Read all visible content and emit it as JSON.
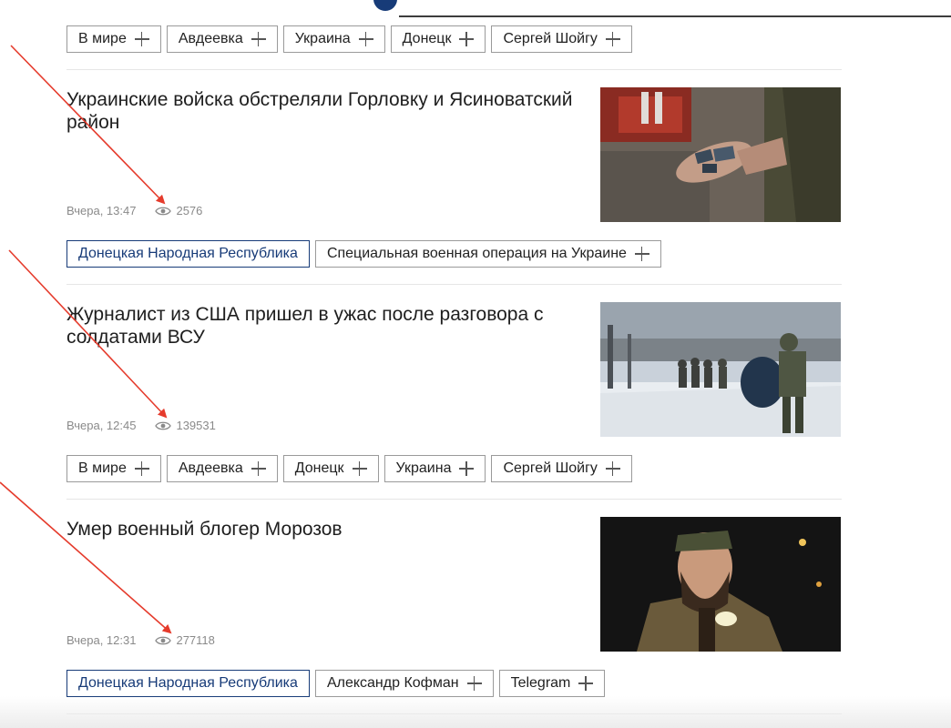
{
  "theme": {
    "accent": "#173b78",
    "arrow": "#e53b2c",
    "meta_text": "#8a8a8a"
  },
  "top_tags": [
    {
      "label": "В мире",
      "active": false
    },
    {
      "label": "Авдеевка",
      "active": false
    },
    {
      "label": "Украина",
      "active": false
    },
    {
      "label": "Донецк",
      "active": false
    },
    {
      "label": "Сергей Шойгу",
      "active": false
    }
  ],
  "articles": [
    {
      "title": "Украинские войска обстреляли Горловку и Ясиноватский район",
      "time": "Вчера, 13:47",
      "views": "2576",
      "image": "soldier-hand-with-shrapnel-photo",
      "tags": [
        {
          "label": "Донецкая Народная Республика",
          "active": true
        },
        {
          "label": "Специальная военная операция на Украине",
          "active": false
        }
      ]
    },
    {
      "title": "Журналист из США пришел в ужас после разговора с солдатами ВСУ",
      "time": "Вчера, 12:45",
      "views": "139531",
      "image": "soldiers-walking-snowy-road-photo",
      "tags": [
        {
          "label": "В мире",
          "active": false
        },
        {
          "label": "Авдеевка",
          "active": false
        },
        {
          "label": "Донецк",
          "active": false
        },
        {
          "label": "Украина",
          "active": false
        },
        {
          "label": "Сергей Шойгу",
          "active": false
        }
      ]
    },
    {
      "title": "Умер военный блогер Морозов",
      "time": "Вчера, 12:31",
      "views": "277118",
      "image": "bearded-man-night-portrait-photo",
      "tags": [
        {
          "label": "Донецкая Народная Республика",
          "active": true
        },
        {
          "label": "Александр Кофман",
          "active": false
        },
        {
          "label": "Telegram",
          "active": false
        }
      ]
    }
  ]
}
